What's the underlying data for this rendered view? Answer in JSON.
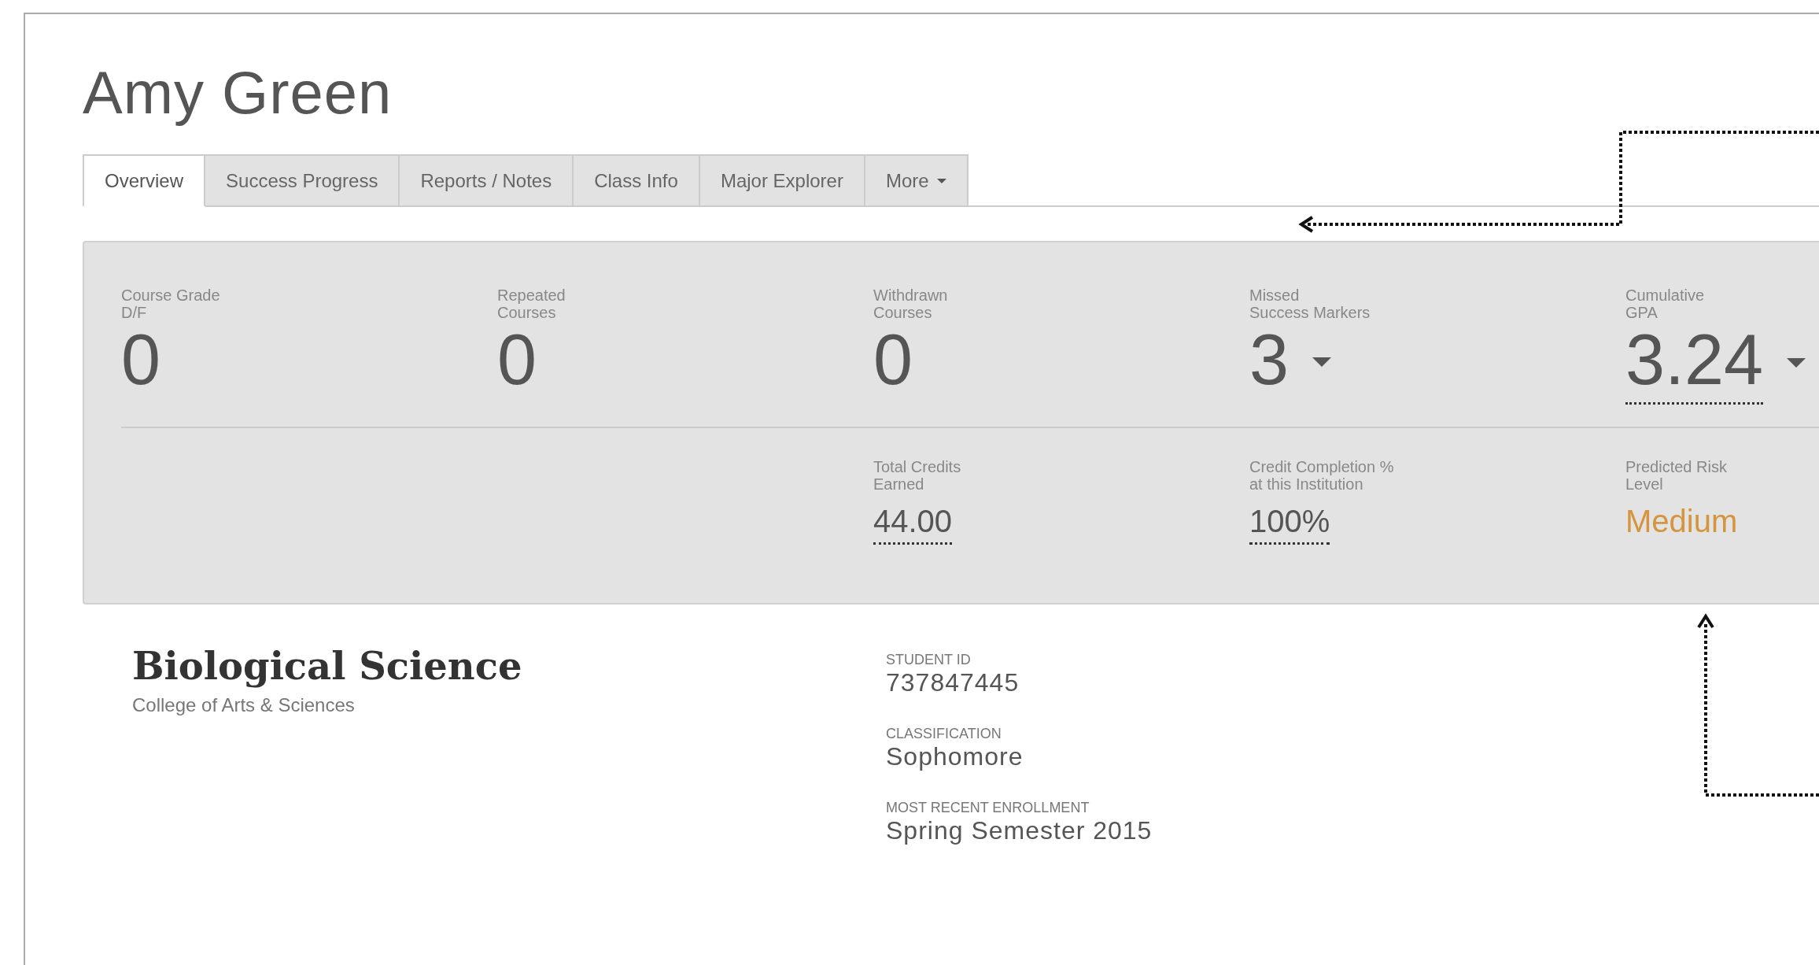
{
  "student": {
    "name": "Amy Green"
  },
  "tabs": [
    {
      "label": "Overview",
      "selected": true,
      "dropdown": false
    },
    {
      "label": "Success Progress",
      "selected": false,
      "dropdown": false
    },
    {
      "label": "Reports / Notes",
      "selected": false,
      "dropdown": false
    },
    {
      "label": "Class Info",
      "selected": false,
      "dropdown": false
    },
    {
      "label": "Major Explorer",
      "selected": false,
      "dropdown": false
    },
    {
      "label": "More",
      "selected": false,
      "dropdown": true
    }
  ],
  "top_stats": [
    {
      "label": "Course Grade\nD/F",
      "value": "0",
      "dropdown": false,
      "underlined": false
    },
    {
      "label": "Repeated\nCourses",
      "value": "0",
      "dropdown": false,
      "underlined": false
    },
    {
      "label": "Withdrawn\nCourses",
      "value": "0",
      "dropdown": false,
      "underlined": false
    },
    {
      "label": "Missed\nSuccess Markers",
      "value": "3",
      "dropdown": true,
      "underlined": false
    },
    {
      "label": "Cumulative\nGPA",
      "value": "3.24",
      "dropdown": true,
      "underlined": true
    }
  ],
  "bottom_stats": [
    {
      "label": "Total Credits\nEarned",
      "value": "44.00",
      "underlined": true,
      "highlight": false
    },
    {
      "label": "Credit Completion %\nat this Institution",
      "value": "100%",
      "underlined": true,
      "highlight": false
    },
    {
      "label": "Predicted Risk\nLevel",
      "value": "Medium",
      "underlined": false,
      "highlight": true
    }
  ],
  "major": {
    "title": "Biological Science",
    "college": "College of Arts & Sciences"
  },
  "details": [
    {
      "label": "STUDENT ID",
      "value": "737847445"
    },
    {
      "label": "CLASSIFICATION",
      "value": "Sophomore"
    },
    {
      "label": "MOST RECENT ENROLLMENT",
      "value": "Spring Semester 2015"
    }
  ]
}
